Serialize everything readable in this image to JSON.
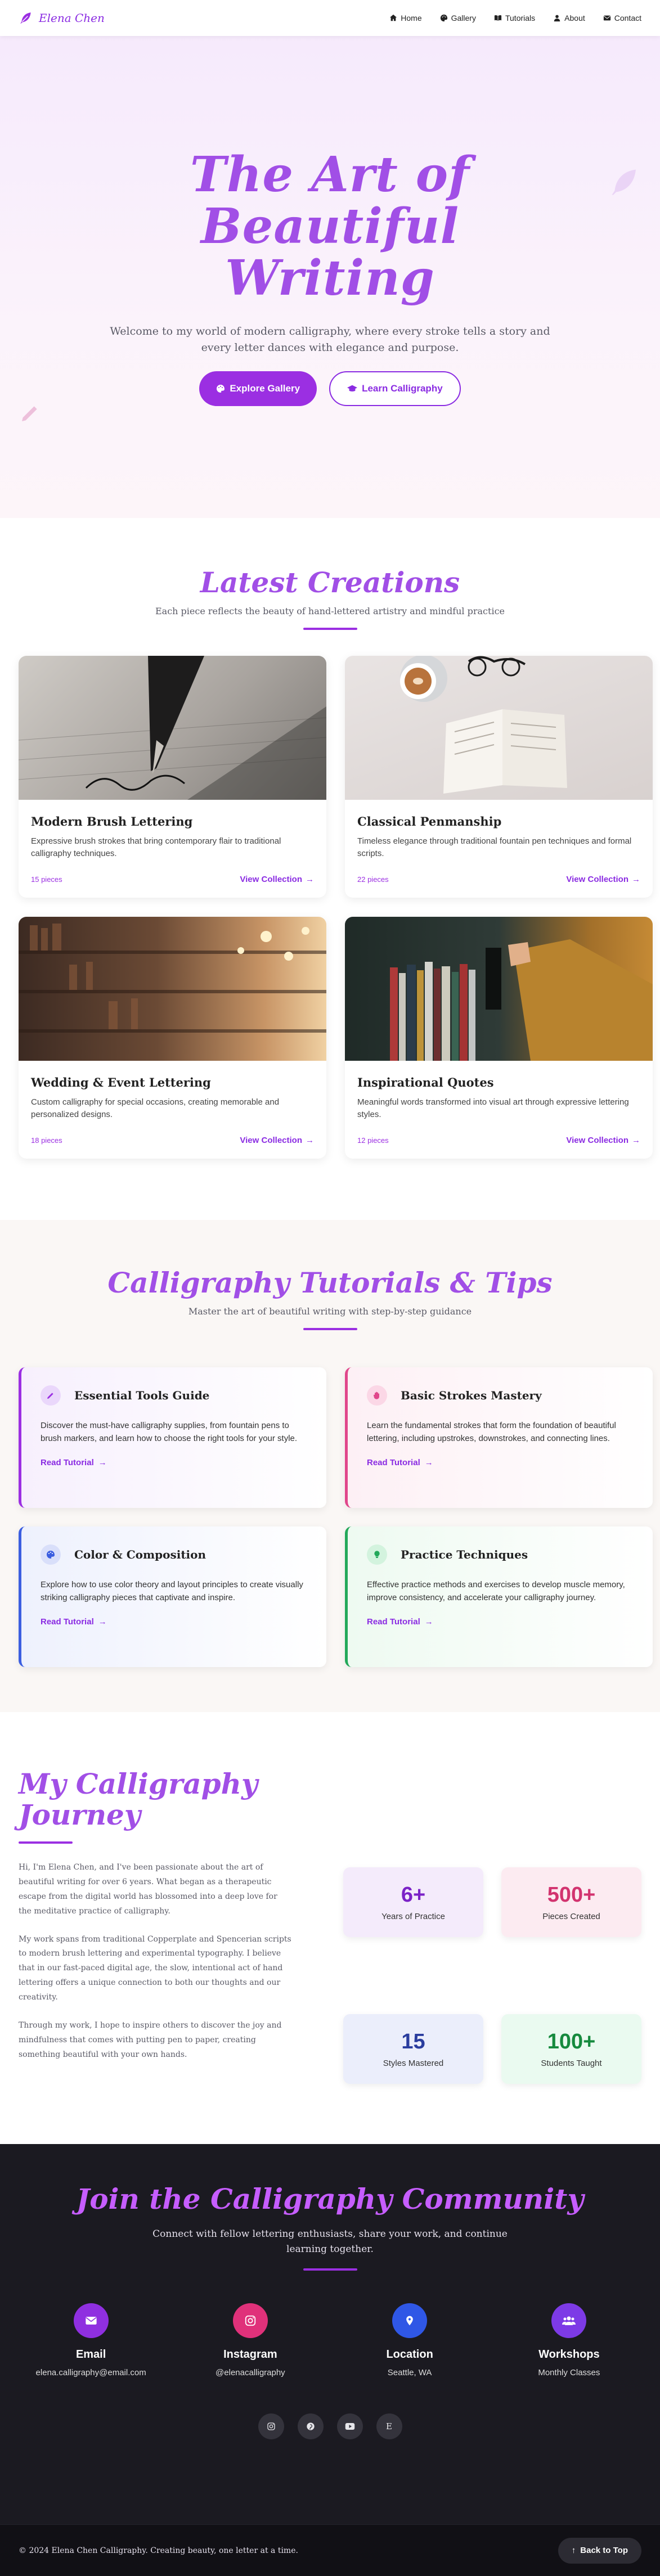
{
  "nav": {
    "brand": "Elena Chen",
    "links": [
      {
        "label": "Home",
        "icon": "home-icon"
      },
      {
        "label": "Gallery",
        "icon": "palette-icon"
      },
      {
        "label": "Tutorials",
        "icon": "book-icon"
      },
      {
        "label": "About",
        "icon": "user-icon"
      },
      {
        "label": "Contact",
        "icon": "envelope-icon"
      }
    ]
  },
  "hero": {
    "title": "The Art of Beautiful Writing",
    "subtitle": "Welcome to my world of modern calligraphy, where every stroke tells a story and every letter dances with elegance and purpose.",
    "primary_button": "Explore Gallery",
    "secondary_button": "Learn Calligraphy"
  },
  "creations": {
    "title": "Latest Creations",
    "subtitle": "Each piece reflects the beauty of hand-lettered artistry and mindful practice",
    "cards": [
      {
        "title": "Modern Brush Lettering",
        "desc": "Expressive brush strokes that bring contemporary flair to traditional calligraphy techniques.",
        "count": "15 pieces",
        "link": "View Collection"
      },
      {
        "title": "Classical Penmanship",
        "desc": "Timeless elegance through traditional fountain pen techniques and formal scripts.",
        "count": "22 pieces",
        "link": "View Collection"
      },
      {
        "title": "Wedding & Event Lettering",
        "desc": "Custom calligraphy for special occasions, creating memorable and personalized designs.",
        "count": "18 pieces",
        "link": "View Collection"
      },
      {
        "title": "Inspirational Quotes",
        "desc": "Meaningful words transformed into visual art through expressive lettering styles.",
        "count": "12 pieces",
        "link": "View Collection"
      }
    ]
  },
  "tutorials": {
    "title": "Calligraphy Tutorials & Tips",
    "subtitle": "Master the art of beautiful writing with step-by-step guidance",
    "items": [
      {
        "title": "Essential Tools Guide",
        "desc": "Discover the must-have calligraphy supplies, from fountain pens to brush markers, and learn how to choose the right tools for your style.",
        "link": "Read Tutorial"
      },
      {
        "title": "Basic Strokes Mastery",
        "desc": "Learn the fundamental strokes that form the foundation of beautiful lettering, including upstrokes, downstrokes, and connecting lines.",
        "link": "Read Tutorial"
      },
      {
        "title": "Color & Composition",
        "desc": "Explore how to use color theory and layout principles to create visually striking calligraphy pieces that captivate and inspire.",
        "link": "Read Tutorial"
      },
      {
        "title": "Practice Techniques",
        "desc": "Effective practice methods and exercises to develop muscle memory, improve consistency, and accelerate your calligraphy journey.",
        "link": "Read Tutorial"
      }
    ]
  },
  "about": {
    "title": "My Calligraphy Journey",
    "paragraphs": [
      "Hi, I'm Elena Chen, and I've been passionate about the art of beautiful writing for over 6 years. What began as a therapeutic escape from the digital world has blossomed into a deep love for the meditative practice of calligraphy.",
      "My work spans from traditional Copperplate and Spencerian scripts to modern brush lettering and experimental typography. I believe that in our fast-paced digital age, the slow, intentional act of hand lettering offers a unique connection to both our thoughts and our creativity.",
      "Through my work, I hope to inspire others to discover the joy and mindfulness that comes with putting pen to paper, creating something beautiful with your own hands."
    ],
    "stats": [
      {
        "value": "6+",
        "label": "Years of Practice",
        "color": "#7b22c7",
        "bg": "#f4ebfb"
      },
      {
        "value": "500+",
        "label": "Pieces Created",
        "color": "#d2336f",
        "bg": "#fcebf1"
      },
      {
        "value": "15",
        "label": "Styles Mastered",
        "color": "#2a3d9e",
        "bg": "#ebeefb"
      },
      {
        "value": "100+",
        "label": "Students Taught",
        "color": "#168a3e",
        "bg": "#eafaf0"
      }
    ]
  },
  "community": {
    "title": "Join the Calligraphy Community",
    "subtitle": "Connect with fellow lettering enthusiasts, share your work, and continue learning together.",
    "contacts": [
      {
        "title": "Email",
        "value": "elena.calligraphy@email.com",
        "icon": "envelope-icon",
        "color": "#8f2fe0"
      },
      {
        "title": "Instagram",
        "value": "@elenacalligraphy",
        "icon": "instagram-icon",
        "color": "#e0317a"
      },
      {
        "title": "Location",
        "value": "Seattle, WA",
        "icon": "location-pin-icon",
        "color": "#2f57e6"
      },
      {
        "title": "Workshops",
        "value": "Monthly Classes",
        "icon": "users-icon",
        "color": "#7d3ae6"
      }
    ],
    "socials": [
      {
        "icon": "instagram-icon",
        "glyph": ""
      },
      {
        "icon": "pinterest-icon",
        "glyph": ""
      },
      {
        "icon": "youtube-icon",
        "glyph": ""
      },
      {
        "icon": "etsy-icon",
        "glyph": "E"
      }
    ]
  },
  "footer": {
    "copyright": "© 2024 Elena Chen Calligraphy. Creating beauty, one letter at a time.",
    "back_to_top": "Back to Top"
  }
}
